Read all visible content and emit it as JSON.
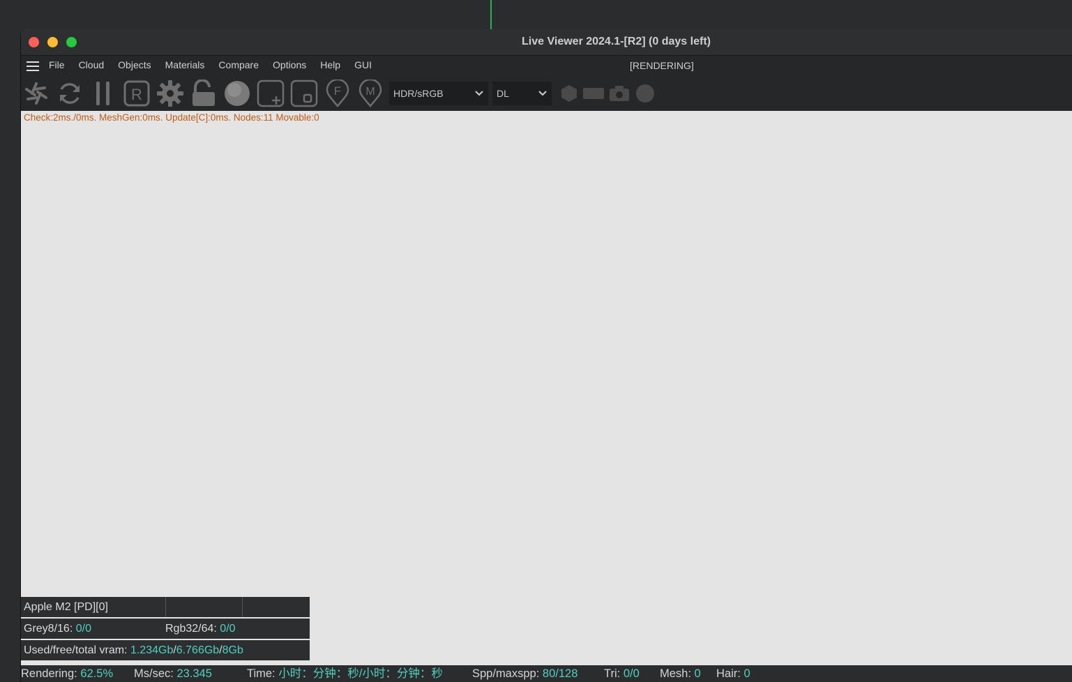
{
  "window": {
    "title": "Live Viewer 2024.1-[R2] (0 days left)"
  },
  "menubar": {
    "items": [
      "File",
      "Cloud",
      "Objects",
      "Materials",
      "Compare",
      "Options",
      "Help",
      "GUI"
    ],
    "status": "[RENDERING]"
  },
  "toolbar": {
    "icons": [
      "aperture-icon",
      "refresh-icon",
      "pause-icon",
      "region-r-icon",
      "settings-gear-icon",
      "unlock-icon",
      "sphere-icon",
      "add-frame-icon",
      "crop-frame-icon",
      "focus-pin-icon",
      "material-pin-icon",
      "hexagon-icon",
      "rectangle-icon",
      "camera-icon",
      "circle-icon"
    ],
    "colorspace_select": "HDR/sRGB",
    "kernel_select": "DL"
  },
  "info_line": "Check:2ms./0ms. MeshGen:0ms. Update[C]:0ms. Nodes:11 Movable:0",
  "gpu_panel": {
    "device": "Apple M2 [PD][0]",
    "grey_label": "Grey8/16:",
    "grey_value": "0/0",
    "rgb_label": "Rgb32/64:",
    "rgb_value": "0/0",
    "vram_label": "Used/free/total vram:",
    "vram_used": "1.234Gb",
    "vram_free": "6.766Gb",
    "vram_total": "8Gb",
    "slash": "/"
  },
  "statusbar": {
    "rendering_label": "Rendering:",
    "rendering_value": "62.5%",
    "ms_label": "Ms/sec:",
    "ms_value": "23.345",
    "time_label": "Time:",
    "time_value": "小时：分钟：秒/小时：分钟：秒",
    "spp_label": "Spp/maxspp:",
    "spp_value": "80/128",
    "tri_label": "Tri:",
    "tri_value": "0/0",
    "mesh_label": "Mesh:",
    "mesh_value": "0",
    "hair_label": "Hair:",
    "hair_value": "0"
  },
  "colors": {
    "accent_value": "#4fd1c1",
    "info_text": "#c25b12",
    "viewport_bg": "#e4e4e4"
  }
}
